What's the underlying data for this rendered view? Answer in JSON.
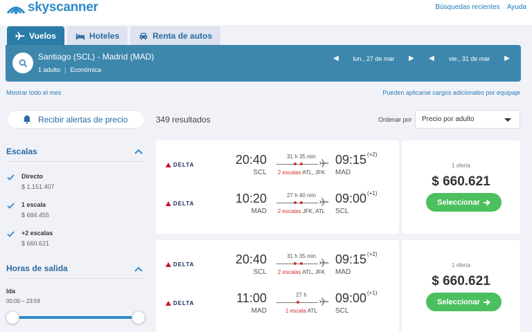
{
  "header": {
    "brand": "skyscanner",
    "links": [
      "Búsquedas recientes",
      "Ayuda"
    ]
  },
  "tabs": [
    {
      "label": "Vuelos",
      "icon": "plane-icon",
      "active": true
    },
    {
      "label": "Hoteles",
      "icon": "bed-icon",
      "active": false
    },
    {
      "label": "Renta de autos",
      "icon": "car-icon",
      "active": false
    }
  ],
  "search": {
    "route": "Santiago (SCL) - Madrid (MAD)",
    "passengers": "1 adulto",
    "cabin": "Económica",
    "depart_date": "lun., 27 de mar",
    "return_date": "vie., 31 de mar"
  },
  "links": {
    "show_month": "Mostrar todo el mes",
    "fees_note": "Pueden aplicarse cargos adicionales por equipaje"
  },
  "alerts": {
    "label": "Recibir alertas de precio"
  },
  "results": {
    "count": "349 resultados",
    "sort_label": "Ordenar por",
    "sort_value": "Precio por adulto"
  },
  "filters": {
    "stops": {
      "title": "Escalas",
      "options": [
        {
          "label": "Directo",
          "price": "$ 1.151.407",
          "checked": true
        },
        {
          "label": "1 escala",
          "price": "$ 684.455",
          "checked": true
        },
        {
          "label": "+2 escalas",
          "price": "$ 660.621",
          "checked": true
        }
      ]
    },
    "departure": {
      "title": "Horas de salida",
      "leg": "Ida",
      "range": "00:00 – 23:59"
    }
  },
  "cards": [
    {
      "legs": [
        {
          "airline": "DELTA",
          "dep_time": "20:40",
          "dep_code": "SCL",
          "duration": "31 h 35 min",
          "stops": "2 escalas",
          "via": "ATL, JFK",
          "stop_count": 2,
          "arr_time": "09:15",
          "day_offset": "(+2)",
          "arr_code": "MAD"
        },
        {
          "airline": "DELTA",
          "dep_time": "10:20",
          "dep_code": "MAD",
          "duration": "27 h 40 min",
          "stops": "2 escalas",
          "via": "JFK, ATL",
          "stop_count": 2,
          "arr_time": "09:00",
          "day_offset": "(+1)",
          "arr_code": "SCL"
        }
      ],
      "offers": "1 oferta",
      "price": "$ 660.621",
      "button": "Seleccionar"
    },
    {
      "legs": [
        {
          "airline": "DELTA",
          "dep_time": "20:40",
          "dep_code": "SCL",
          "duration": "31 h 35 min",
          "stops": "2 escalas",
          "via": "ATL, JFK",
          "stop_count": 2,
          "arr_time": "09:15",
          "day_offset": "(+2)",
          "arr_code": "MAD"
        },
        {
          "airline": "DELTA",
          "dep_time": "11:00",
          "dep_code": "MAD",
          "duration": "27 h",
          "stops": "1 escala",
          "via": "ATL",
          "stop_count": 1,
          "arr_time": "09:00",
          "day_offset": "(+1)",
          "arr_code": "SCL"
        }
      ],
      "offers": "1 oferta",
      "price": "$ 660.621",
      "button": "Seleccionar"
    }
  ],
  "colors": {
    "brand_blue": "#2f8ac8",
    "search_bar": "#3d87ad",
    "select_green": "#4cbf5f",
    "stop_red": "#d0312d"
  }
}
